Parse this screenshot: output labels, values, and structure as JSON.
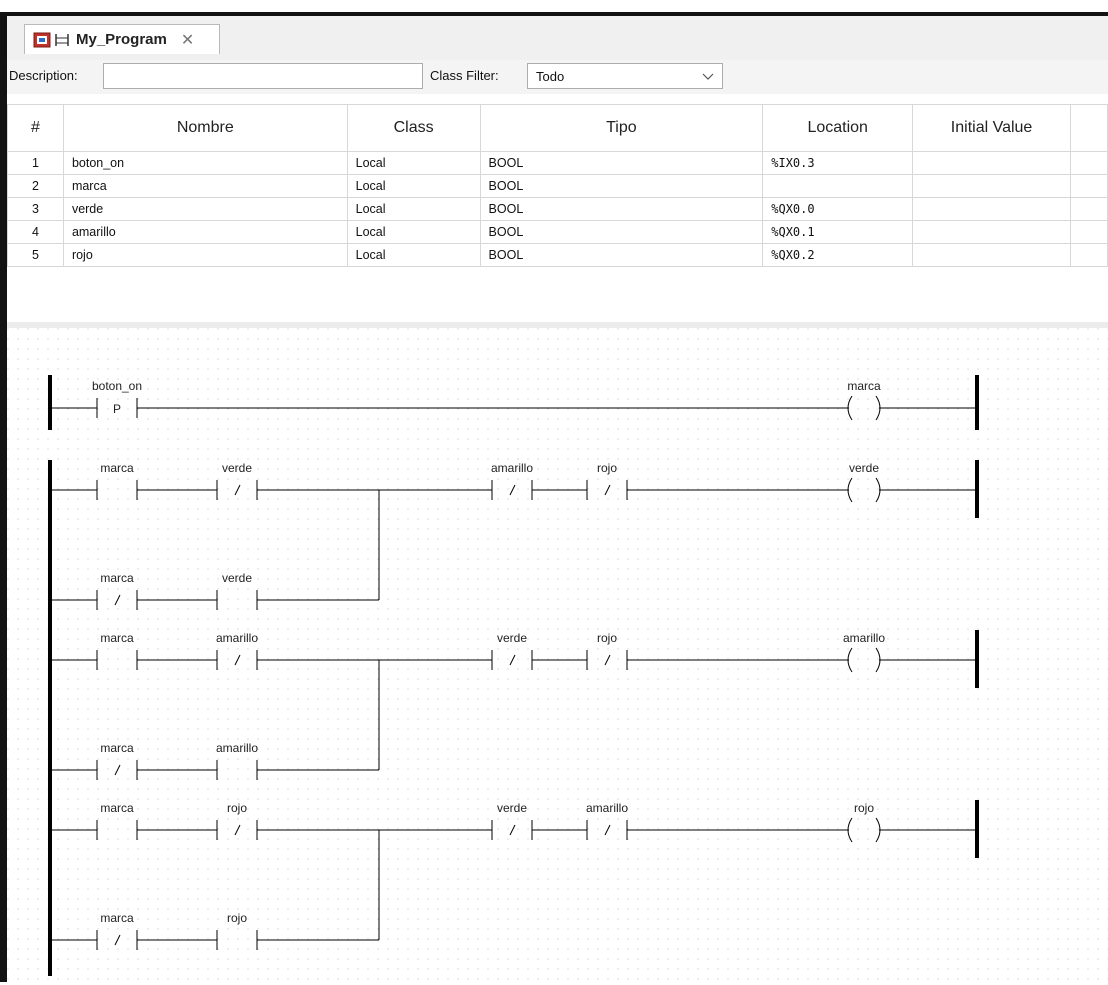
{
  "tab": {
    "title": "My_Program",
    "close_glyph": "✕"
  },
  "filters": {
    "description_label": "Description:",
    "description_value": "",
    "class_label": "Class Filter:",
    "class_value": "Todo"
  },
  "table": {
    "headers": [
      "#",
      "Nombre",
      "Class",
      "Tipo",
      "Location",
      "Initial Value"
    ],
    "rows": [
      {
        "num": "1",
        "name": "boton_on",
        "class": "Local",
        "type": "BOOL",
        "location": "%IX0.3",
        "initial": ""
      },
      {
        "num": "2",
        "name": "marca",
        "class": "Local",
        "type": "BOOL",
        "location": "",
        "initial": ""
      },
      {
        "num": "3",
        "name": "verde",
        "class": "Local",
        "type": "BOOL",
        "location": "%QX0.0",
        "initial": ""
      },
      {
        "num": "4",
        "name": "amarillo",
        "class": "Local",
        "type": "BOOL",
        "location": "%QX0.1",
        "initial": ""
      },
      {
        "num": "5",
        "name": "rojo",
        "class": "Local",
        "type": "BOOL",
        "location": "%QX0.2",
        "initial": ""
      }
    ]
  },
  "ladder": {
    "rungs": [
      {
        "elements": [
          {
            "kind": "contact",
            "mode": "P",
            "label": "boton_on"
          }
        ],
        "parallel": null,
        "series": [],
        "coil": "marca"
      },
      {
        "elements": [
          {
            "kind": "contact",
            "mode": "NO",
            "label": "marca"
          },
          {
            "kind": "contact",
            "mode": "NC",
            "label": "verde"
          }
        ],
        "parallel": [
          {
            "kind": "contact",
            "mode": "NC",
            "label": "marca"
          },
          {
            "kind": "contact",
            "mode": "NO",
            "label": "verde"
          }
        ],
        "series": [
          {
            "kind": "contact",
            "mode": "NC",
            "label": "amarillo"
          },
          {
            "kind": "contact",
            "mode": "NC",
            "label": "rojo"
          }
        ],
        "coil": "verde"
      },
      {
        "elements": [
          {
            "kind": "contact",
            "mode": "NO",
            "label": "marca"
          },
          {
            "kind": "contact",
            "mode": "NC",
            "label": "amarillo"
          }
        ],
        "parallel": [
          {
            "kind": "contact",
            "mode": "NC",
            "label": "marca"
          },
          {
            "kind": "contact",
            "mode": "NO",
            "label": "amarillo"
          }
        ],
        "series": [
          {
            "kind": "contact",
            "mode": "NC",
            "label": "verde"
          },
          {
            "kind": "contact",
            "mode": "NC",
            "label": "rojo"
          }
        ],
        "coil": "amarillo"
      },
      {
        "elements": [
          {
            "kind": "contact",
            "mode": "NO",
            "label": "marca"
          },
          {
            "kind": "contact",
            "mode": "NC",
            "label": "rojo"
          }
        ],
        "parallel": [
          {
            "kind": "contact",
            "mode": "NC",
            "label": "marca"
          },
          {
            "kind": "contact",
            "mode": "NO",
            "label": "rojo"
          }
        ],
        "series": [
          {
            "kind": "contact",
            "mode": "NC",
            "label": "verde"
          },
          {
            "kind": "contact",
            "mode": "NC",
            "label": "amarillo"
          }
        ],
        "coil": "rojo"
      }
    ]
  }
}
